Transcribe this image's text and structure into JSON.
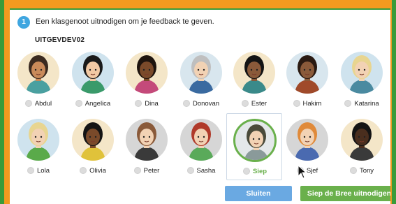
{
  "dialog": {
    "step_number": "1",
    "title": "Een klasgenoot uitnodigen om je feedback te geven.",
    "class_name": "UITGEVDEV02"
  },
  "students": [
    {
      "name": "Abdul",
      "bg": "#f4e6c8",
      "skin": "#c98a5a",
      "hair": "#3a2a20",
      "shirt": "#4aa0a0",
      "selected": false
    },
    {
      "name": "Angelica",
      "bg": "#cfe3ee",
      "skin": "#f2c9a4",
      "hair": "#1a1a1a",
      "shirt": "#3a9a6a",
      "selected": false
    },
    {
      "name": "Dina",
      "bg": "#f4e6c8",
      "skin": "#7a4a2a",
      "hair": "#1e140e",
      "shirt": "#c44a7a",
      "selected": false
    },
    {
      "name": "Donovan",
      "bg": "#d8e6ee",
      "skin": "#f2d2b4",
      "hair": "#bfbfbf",
      "shirt": "#3a6aa0",
      "selected": false
    },
    {
      "name": "Ester",
      "bg": "#f4e6c8",
      "skin": "#8a5a3a",
      "hair": "#141414",
      "shirt": "#3a8a8a",
      "selected": false
    },
    {
      "name": "Hakim",
      "bg": "#d8e6ee",
      "skin": "#8a5a3a",
      "hair": "#2a1a12",
      "shirt": "#a04a2a",
      "selected": false
    },
    {
      "name": "Katarina",
      "bg": "#cfe3ee",
      "skin": "#f2d2b4",
      "hair": "#e8d590",
      "shirt": "#4a8aa0",
      "selected": false
    },
    {
      "name": "Lola",
      "bg": "#cfe3ee",
      "skin": "#f2d2b4",
      "hair": "#e8d590",
      "shirt": "#5aaa4a",
      "selected": false
    },
    {
      "name": "Olivia",
      "bg": "#f4e6c8",
      "skin": "#7a4a2a",
      "hair": "#141414",
      "shirt": "#e0c23a",
      "selected": false
    },
    {
      "name": "Peter",
      "bg": "#d6d6d6",
      "skin": "#f2d2b4",
      "hair": "#8a5a3a",
      "shirt": "#3a3a3a",
      "selected": false
    },
    {
      "name": "Sasha",
      "bg": "#d6d6d6",
      "skin": "#f2d2b4",
      "hair": "#b03a2a",
      "shirt": "#5aaa5a",
      "selected": false
    },
    {
      "name": "Siep",
      "bg": "#e4e8ea",
      "skin": "#f2d2b4",
      "hair": "#4a4a3a",
      "shirt": "#8a9a9a",
      "selected": true
    },
    {
      "name": "Sjef",
      "bg": "#d6d6d6",
      "skin": "#f2d2b4",
      "hair": "#e08a3a",
      "shirt": "#4a6ab0",
      "selected": false
    },
    {
      "name": "Tony",
      "bg": "#f4e6c8",
      "skin": "#4a2e1e",
      "hair": "#141414",
      "shirt": "#3a3a3a",
      "selected": false
    }
  ],
  "buttons": {
    "close_label": "Sluiten",
    "invite_label": "Siep de Bree uitnodigen"
  }
}
